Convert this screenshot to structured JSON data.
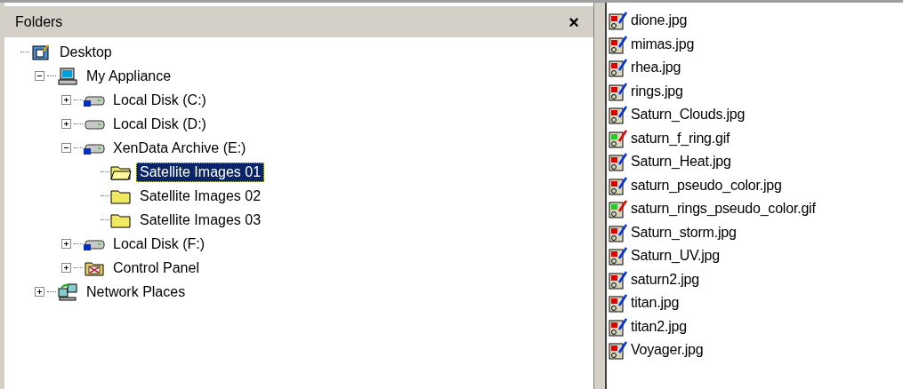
{
  "folders_pane": {
    "title": "Folders",
    "close": "×",
    "tree": [
      {
        "label": "Desktop",
        "kind": "desktop",
        "selected": false,
        "children": [
          {
            "label": "My Appliance",
            "kind": "computer",
            "expanded": true,
            "selected": false,
            "children": [
              {
                "label": "Local Disk (C:)",
                "kind": "disk",
                "expanded": false,
                "selected": false
              },
              {
                "label": "Local Disk (D:)",
                "kind": "drive",
                "expanded": false,
                "selected": false
              },
              {
                "label": "XenData Archive (E:)",
                "kind": "disk",
                "expanded": true,
                "selected": false,
                "children": [
                  {
                    "label": "Satellite Images 01",
                    "kind": "open-folder",
                    "selected": true
                  },
                  {
                    "label": "Satellite Images 02",
                    "kind": "folder",
                    "selected": false
                  },
                  {
                    "label": "Satellite Images 03",
                    "kind": "folder",
                    "selected": false
                  }
                ]
              },
              {
                "label": "Local Disk (F:)",
                "kind": "disk",
                "expanded": false,
                "selected": false
              },
              {
                "label": "Control Panel",
                "kind": "control-panel",
                "expanded": false,
                "selected": false
              }
            ]
          },
          {
            "label": "Network Places",
            "kind": "network",
            "expanded": false,
            "selected": false
          }
        ]
      }
    ]
  },
  "files": [
    {
      "name": "dione.jpg",
      "kind": "jpg"
    },
    {
      "name": "mimas.jpg",
      "kind": "jpg"
    },
    {
      "name": "rhea.jpg",
      "kind": "jpg"
    },
    {
      "name": "rings.jpg",
      "kind": "jpg"
    },
    {
      "name": "Saturn_Clouds.jpg",
      "kind": "jpg"
    },
    {
      "name": "saturn_f_ring.gif",
      "kind": "gif"
    },
    {
      "name": "Saturn_Heat.jpg",
      "kind": "jpg"
    },
    {
      "name": "saturn_pseudo_color.jpg",
      "kind": "jpg"
    },
    {
      "name": "saturn_rings_pseudo_color.gif",
      "kind": "gif"
    },
    {
      "name": "Saturn_storm.jpg",
      "kind": "jpg"
    },
    {
      "name": "Saturn_UV.jpg",
      "kind": "jpg"
    },
    {
      "name": "saturn2.jpg",
      "kind": "jpg"
    },
    {
      "name": "titan.jpg",
      "kind": "jpg"
    },
    {
      "name": "titan2.jpg",
      "kind": "jpg"
    },
    {
      "name": "Voyager.jpg",
      "kind": "jpg"
    }
  ]
}
